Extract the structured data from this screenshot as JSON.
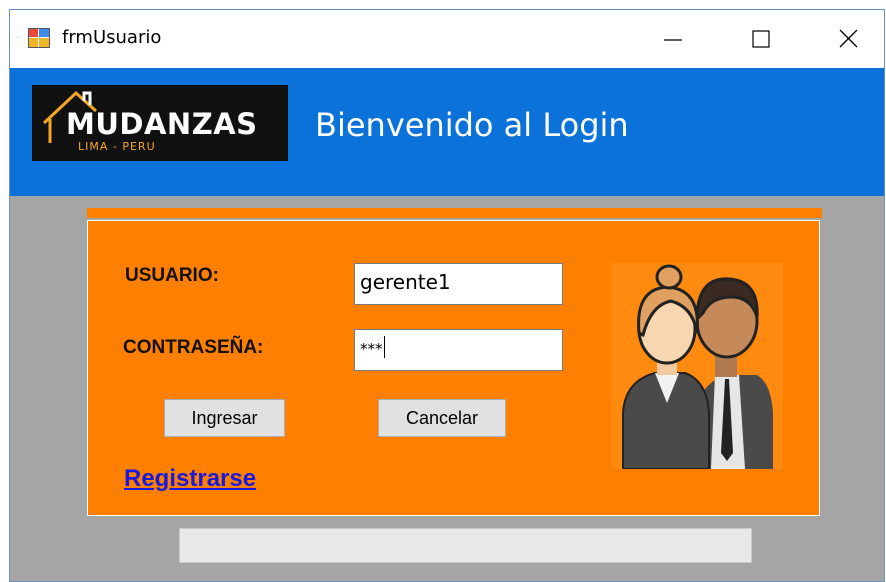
{
  "window": {
    "title": "frmUsuario",
    "controls": [
      "minimize-icon",
      "maximize-icon",
      "close-icon"
    ]
  },
  "header": {
    "logo_text": "MUDANZAS",
    "logo_subtext": "LIMA - PERU",
    "title": "Bienvenido al Login"
  },
  "form": {
    "user_label": "USUARIO:",
    "user_value": "gerente1",
    "password_label": "CONTRASEÑA:",
    "password_value": "***",
    "login_button": "Ingresar",
    "cancel_button": "Cancelar",
    "register_link": "Registrarse"
  },
  "icons": {
    "people_image": "users-icon",
    "app_icon": "window-app-icon"
  },
  "colors": {
    "header_bg": "#0a72d8",
    "panel_bg": "#ff7f00",
    "link": "#1a1adc",
    "background": "#a5a5a5"
  }
}
